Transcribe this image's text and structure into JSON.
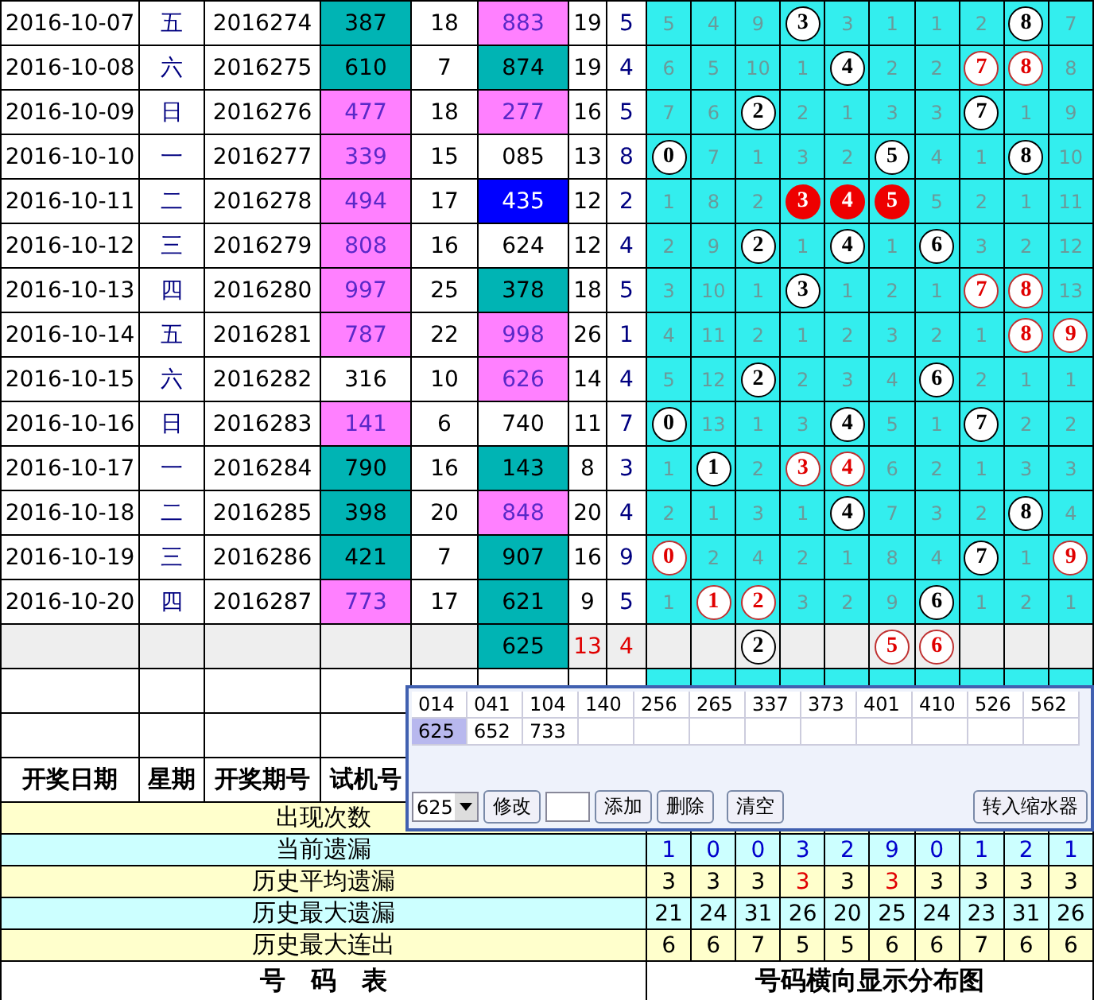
{
  "rows": [
    {
      "date": "2016-10-07",
      "weekday": "五",
      "issue": "2016274",
      "trial": {
        "text": "387",
        "color": "#00b4b4"
      },
      "trial_sum": "18",
      "result": {
        "text": "883",
        "color": "#ff80ff"
      },
      "result_sum": "19",
      "span": "5",
      "cells": [
        {
          "text": "5",
          "kind": "miss"
        },
        {
          "text": "4",
          "kind": "miss"
        },
        {
          "text": "9",
          "kind": "miss"
        },
        {
          "text": "3",
          "kind": "ball"
        },
        {
          "text": "3",
          "kind": "miss"
        },
        {
          "text": "1",
          "kind": "miss"
        },
        {
          "text": "1",
          "kind": "miss"
        },
        {
          "text": "2",
          "kind": "miss"
        },
        {
          "text": "8",
          "kind": "ball"
        },
        {
          "text": "7",
          "kind": "miss"
        }
      ]
    },
    {
      "date": "2016-10-08",
      "weekday": "六",
      "issue": "2016275",
      "trial": {
        "text": "610",
        "color": "#00b4b4"
      },
      "trial_sum": "7",
      "result": {
        "text": "874",
        "color": "#00b4b4"
      },
      "result_sum": "19",
      "span": "4",
      "cells": [
        {
          "text": "6",
          "kind": "miss"
        },
        {
          "text": "5",
          "kind": "miss"
        },
        {
          "text": "10",
          "kind": "miss"
        },
        {
          "text": "1",
          "kind": "miss"
        },
        {
          "text": "4",
          "kind": "ball"
        },
        {
          "text": "2",
          "kind": "miss"
        },
        {
          "text": "2",
          "kind": "miss"
        },
        {
          "text": "7",
          "kind": "ring"
        },
        {
          "text": "8",
          "kind": "ring"
        },
        {
          "text": "8",
          "kind": "miss"
        }
      ]
    },
    {
      "date": "2016-10-09",
      "weekday": "日",
      "issue": "2016276",
      "trial": {
        "text": "477",
        "color": "#ff80ff"
      },
      "trial_sum": "18",
      "result": {
        "text": "277",
        "color": "#ff80ff"
      },
      "result_sum": "16",
      "span": "5",
      "cells": [
        {
          "text": "7",
          "kind": "miss"
        },
        {
          "text": "6",
          "kind": "miss"
        },
        {
          "text": "2",
          "kind": "ball"
        },
        {
          "text": "2",
          "kind": "miss"
        },
        {
          "text": "1",
          "kind": "miss"
        },
        {
          "text": "3",
          "kind": "miss"
        },
        {
          "text": "3",
          "kind": "miss"
        },
        {
          "text": "7",
          "kind": "ball"
        },
        {
          "text": "1",
          "kind": "miss"
        },
        {
          "text": "9",
          "kind": "miss"
        }
      ]
    },
    {
      "date": "2016-10-10",
      "weekday": "一",
      "issue": "2016277",
      "trial": {
        "text": "339",
        "color": "#ff80ff"
      },
      "trial_sum": "15",
      "result": {
        "text": "085",
        "color": "#ffffff"
      },
      "result_sum": "13",
      "span": "8",
      "cells": [
        {
          "text": "0",
          "kind": "ball"
        },
        {
          "text": "7",
          "kind": "miss"
        },
        {
          "text": "1",
          "kind": "miss"
        },
        {
          "text": "3",
          "kind": "miss"
        },
        {
          "text": "2",
          "kind": "miss"
        },
        {
          "text": "5",
          "kind": "ball"
        },
        {
          "text": "4",
          "kind": "miss"
        },
        {
          "text": "1",
          "kind": "miss"
        },
        {
          "text": "8",
          "kind": "ball"
        },
        {
          "text": "10",
          "kind": "miss"
        }
      ]
    },
    {
      "date": "2016-10-11",
      "weekday": "二",
      "issue": "2016278",
      "trial": {
        "text": "494",
        "color": "#ff80ff"
      },
      "trial_sum": "17",
      "result": {
        "text": "435",
        "color": "#0000ff"
      },
      "result_sum": "12",
      "span": "2",
      "cells": [
        {
          "text": "1",
          "kind": "miss"
        },
        {
          "text": "8",
          "kind": "miss"
        },
        {
          "text": "2",
          "kind": "miss"
        },
        {
          "text": "3",
          "kind": "solid"
        },
        {
          "text": "4",
          "kind": "solid"
        },
        {
          "text": "5",
          "kind": "solid"
        },
        {
          "text": "5",
          "kind": "miss"
        },
        {
          "text": "2",
          "kind": "miss"
        },
        {
          "text": "1",
          "kind": "miss"
        },
        {
          "text": "11",
          "kind": "miss"
        }
      ]
    },
    {
      "date": "2016-10-12",
      "weekday": "三",
      "issue": "2016279",
      "trial": {
        "text": "808",
        "color": "#ff80ff"
      },
      "trial_sum": "16",
      "result": {
        "text": "624",
        "color": "#ffffff"
      },
      "result_sum": "12",
      "span": "4",
      "cells": [
        {
          "text": "2",
          "kind": "miss"
        },
        {
          "text": "9",
          "kind": "miss"
        },
        {
          "text": "2",
          "kind": "ball"
        },
        {
          "text": "1",
          "kind": "miss"
        },
        {
          "text": "4",
          "kind": "ball"
        },
        {
          "text": "1",
          "kind": "miss"
        },
        {
          "text": "6",
          "kind": "ball"
        },
        {
          "text": "3",
          "kind": "miss"
        },
        {
          "text": "2",
          "kind": "miss"
        },
        {
          "text": "12",
          "kind": "miss"
        }
      ]
    },
    {
      "date": "2016-10-13",
      "weekday": "四",
      "issue": "2016280",
      "trial": {
        "text": "997",
        "color": "#ff80ff"
      },
      "trial_sum": "25",
      "result": {
        "text": "378",
        "color": "#00b4b4"
      },
      "result_sum": "18",
      "span": "5",
      "cells": [
        {
          "text": "3",
          "kind": "miss"
        },
        {
          "text": "10",
          "kind": "miss"
        },
        {
          "text": "1",
          "kind": "miss"
        },
        {
          "text": "3",
          "kind": "ball"
        },
        {
          "text": "1",
          "kind": "miss"
        },
        {
          "text": "2",
          "kind": "miss"
        },
        {
          "text": "1",
          "kind": "miss"
        },
        {
          "text": "7",
          "kind": "ring"
        },
        {
          "text": "8",
          "kind": "ring"
        },
        {
          "text": "13",
          "kind": "miss"
        }
      ]
    },
    {
      "date": "2016-10-14",
      "weekday": "五",
      "issue": "2016281",
      "trial": {
        "text": "787",
        "color": "#ff80ff"
      },
      "trial_sum": "22",
      "result": {
        "text": "998",
        "color": "#ff80ff"
      },
      "result_sum": "26",
      "span": "1",
      "cells": [
        {
          "text": "4",
          "kind": "miss"
        },
        {
          "text": "11",
          "kind": "miss"
        },
        {
          "text": "2",
          "kind": "miss"
        },
        {
          "text": "1",
          "kind": "miss"
        },
        {
          "text": "2",
          "kind": "miss"
        },
        {
          "text": "3",
          "kind": "miss"
        },
        {
          "text": "2",
          "kind": "miss"
        },
        {
          "text": "1",
          "kind": "miss"
        },
        {
          "text": "8",
          "kind": "ring"
        },
        {
          "text": "9",
          "kind": "ring"
        }
      ]
    },
    {
      "date": "2016-10-15",
      "weekday": "六",
      "issue": "2016282",
      "trial": {
        "text": "316",
        "color": "#ffffff"
      },
      "trial_sum": "10",
      "result": {
        "text": "626",
        "color": "#ff80ff"
      },
      "result_sum": "14",
      "span": "4",
      "cells": [
        {
          "text": "5",
          "kind": "miss"
        },
        {
          "text": "12",
          "kind": "miss"
        },
        {
          "text": "2",
          "kind": "ball"
        },
        {
          "text": "2",
          "kind": "miss"
        },
        {
          "text": "3",
          "kind": "miss"
        },
        {
          "text": "4",
          "kind": "miss"
        },
        {
          "text": "6",
          "kind": "ball"
        },
        {
          "text": "2",
          "kind": "miss"
        },
        {
          "text": "1",
          "kind": "miss"
        },
        {
          "text": "1",
          "kind": "miss"
        }
      ]
    },
    {
      "date": "2016-10-16",
      "weekday": "日",
      "issue": "2016283",
      "trial": {
        "text": "141",
        "color": "#ff80ff"
      },
      "trial_sum": "6",
      "result": {
        "text": "740",
        "color": "#ffffff"
      },
      "result_sum": "11",
      "span": "7",
      "cells": [
        {
          "text": "0",
          "kind": "ball"
        },
        {
          "text": "13",
          "kind": "miss"
        },
        {
          "text": "1",
          "kind": "miss"
        },
        {
          "text": "3",
          "kind": "miss"
        },
        {
          "text": "4",
          "kind": "ball"
        },
        {
          "text": "5",
          "kind": "miss"
        },
        {
          "text": "1",
          "kind": "miss"
        },
        {
          "text": "7",
          "kind": "ball"
        },
        {
          "text": "2",
          "kind": "miss"
        },
        {
          "text": "2",
          "kind": "miss"
        }
      ]
    },
    {
      "date": "2016-10-17",
      "weekday": "一",
      "issue": "2016284",
      "trial": {
        "text": "790",
        "color": "#00b4b4"
      },
      "trial_sum": "16",
      "result": {
        "text": "143",
        "color": "#00b4b4"
      },
      "result_sum": "8",
      "span": "3",
      "cells": [
        {
          "text": "1",
          "kind": "miss"
        },
        {
          "text": "1",
          "kind": "ball"
        },
        {
          "text": "2",
          "kind": "miss"
        },
        {
          "text": "3",
          "kind": "ring"
        },
        {
          "text": "4",
          "kind": "ring"
        },
        {
          "text": "6",
          "kind": "miss"
        },
        {
          "text": "2",
          "kind": "miss"
        },
        {
          "text": "1",
          "kind": "miss"
        },
        {
          "text": "3",
          "kind": "miss"
        },
        {
          "text": "3",
          "kind": "miss"
        }
      ]
    },
    {
      "date": "2016-10-18",
      "weekday": "二",
      "issue": "2016285",
      "trial": {
        "text": "398",
        "color": "#00b4b4"
      },
      "trial_sum": "20",
      "result": {
        "text": "848",
        "color": "#ff80ff"
      },
      "result_sum": "20",
      "span": "4",
      "cells": [
        {
          "text": "2",
          "kind": "miss"
        },
        {
          "text": "1",
          "kind": "miss"
        },
        {
          "text": "3",
          "kind": "miss"
        },
        {
          "text": "1",
          "kind": "miss"
        },
        {
          "text": "4",
          "kind": "ball"
        },
        {
          "text": "7",
          "kind": "miss"
        },
        {
          "text": "3",
          "kind": "miss"
        },
        {
          "text": "2",
          "kind": "miss"
        },
        {
          "text": "8",
          "kind": "ball"
        },
        {
          "text": "4",
          "kind": "miss"
        }
      ]
    },
    {
      "date": "2016-10-19",
      "weekday": "三",
      "issue": "2016286",
      "trial": {
        "text": "421",
        "color": "#00b4b4"
      },
      "trial_sum": "7",
      "result": {
        "text": "907",
        "color": "#00b4b4"
      },
      "result_sum": "16",
      "span": "9",
      "cells": [
        {
          "text": "0",
          "kind": "ring"
        },
        {
          "text": "2",
          "kind": "miss"
        },
        {
          "text": "4",
          "kind": "miss"
        },
        {
          "text": "2",
          "kind": "miss"
        },
        {
          "text": "1",
          "kind": "miss"
        },
        {
          "text": "8",
          "kind": "miss"
        },
        {
          "text": "4",
          "kind": "miss"
        },
        {
          "text": "7",
          "kind": "ball"
        },
        {
          "text": "1",
          "kind": "miss"
        },
        {
          "text": "9",
          "kind": "ring"
        }
      ]
    },
    {
      "date": "2016-10-20",
      "weekday": "四",
      "issue": "2016287",
      "trial": {
        "text": "773",
        "color": "#ff80ff"
      },
      "trial_sum": "17",
      "result": {
        "text": "621",
        "color": "#00b4b4"
      },
      "result_sum": "9",
      "span": "5",
      "cells": [
        {
          "text": "1",
          "kind": "miss"
        },
        {
          "text": "1",
          "kind": "ring"
        },
        {
          "text": "2",
          "kind": "ring"
        },
        {
          "text": "3",
          "kind": "miss"
        },
        {
          "text": "2",
          "kind": "miss"
        },
        {
          "text": "9",
          "kind": "miss"
        },
        {
          "text": "6",
          "kind": "ball"
        },
        {
          "text": "1",
          "kind": "miss"
        },
        {
          "text": "2",
          "kind": "miss"
        },
        {
          "text": "1",
          "kind": "miss"
        }
      ]
    }
  ],
  "forecast_row": {
    "result": {
      "text": "625",
      "color": "#00b4b4"
    },
    "result_sum": "13",
    "span": "4",
    "cells": [
      {
        "text": "",
        "kind": "empty"
      },
      {
        "text": "",
        "kind": "empty"
      },
      {
        "text": "2",
        "kind": "ball"
      },
      {
        "text": "",
        "kind": "empty"
      },
      {
        "text": "",
        "kind": "empty"
      },
      {
        "text": "5",
        "kind": "ring"
      },
      {
        "text": "6",
        "kind": "ring"
      },
      {
        "text": "",
        "kind": "empty"
      },
      {
        "text": "",
        "kind": "empty"
      },
      {
        "text": "",
        "kind": "empty"
      }
    ]
  },
  "header": [
    "开奖日期",
    "星期",
    "开奖期号",
    "试机号"
  ],
  "stats": [
    {
      "kind": "count",
      "label": "出现次数"
    },
    {
      "kind": "current",
      "label": "当前遗漏",
      "values": [
        "1",
        "0",
        "0",
        "3",
        "2",
        "9",
        "0",
        "1",
        "2",
        "1"
      ]
    },
    {
      "kind": "average",
      "label": "历史平均遗漏",
      "values": [
        {
          "text": "3",
          "alert": false
        },
        {
          "text": "3",
          "alert": false
        },
        {
          "text": "3",
          "alert": false
        },
        {
          "text": "3",
          "alert": true
        },
        {
          "text": "3",
          "alert": false
        },
        {
          "text": "3",
          "alert": true
        },
        {
          "text": "3",
          "alert": false
        },
        {
          "text": "3",
          "alert": false
        },
        {
          "text": "3",
          "alert": false
        },
        {
          "text": "3",
          "alert": false
        }
      ]
    },
    {
      "kind": "max_miss",
      "label": "历史最大遗漏",
      "values": [
        "21",
        "24",
        "31",
        "26",
        "20",
        "25",
        "24",
        "23",
        "31",
        "26"
      ]
    },
    {
      "kind": "max_run",
      "label": "历史最大连出",
      "values": [
        "6",
        "6",
        "7",
        "5",
        "5",
        "6",
        "6",
        "7",
        "6",
        "6"
      ]
    }
  ],
  "footer": {
    "left": "号　码　表",
    "right": "号码横向显示分布图"
  },
  "popup": {
    "numbers": [
      {
        "text": "014",
        "selected": false
      },
      {
        "text": "041",
        "selected": false
      },
      {
        "text": "104",
        "selected": false
      },
      {
        "text": "140",
        "selected": false
      },
      {
        "text": "256",
        "selected": false
      },
      {
        "text": "265",
        "selected": false
      },
      {
        "text": "337",
        "selected": false
      },
      {
        "text": "373",
        "selected": false
      },
      {
        "text": "401",
        "selected": false
      },
      {
        "text": "410",
        "selected": false
      },
      {
        "text": "526",
        "selected": false
      },
      {
        "text": "562",
        "selected": false
      },
      {
        "text": "625",
        "selected": true
      },
      {
        "text": "652",
        "selected": false
      },
      {
        "text": "733",
        "selected": false
      }
    ],
    "select_value": "625",
    "edit_button": "修改",
    "add_button": "添加",
    "delete_button": "删除",
    "clear_button": "清空",
    "transfer_button": "转入缩水器"
  }
}
